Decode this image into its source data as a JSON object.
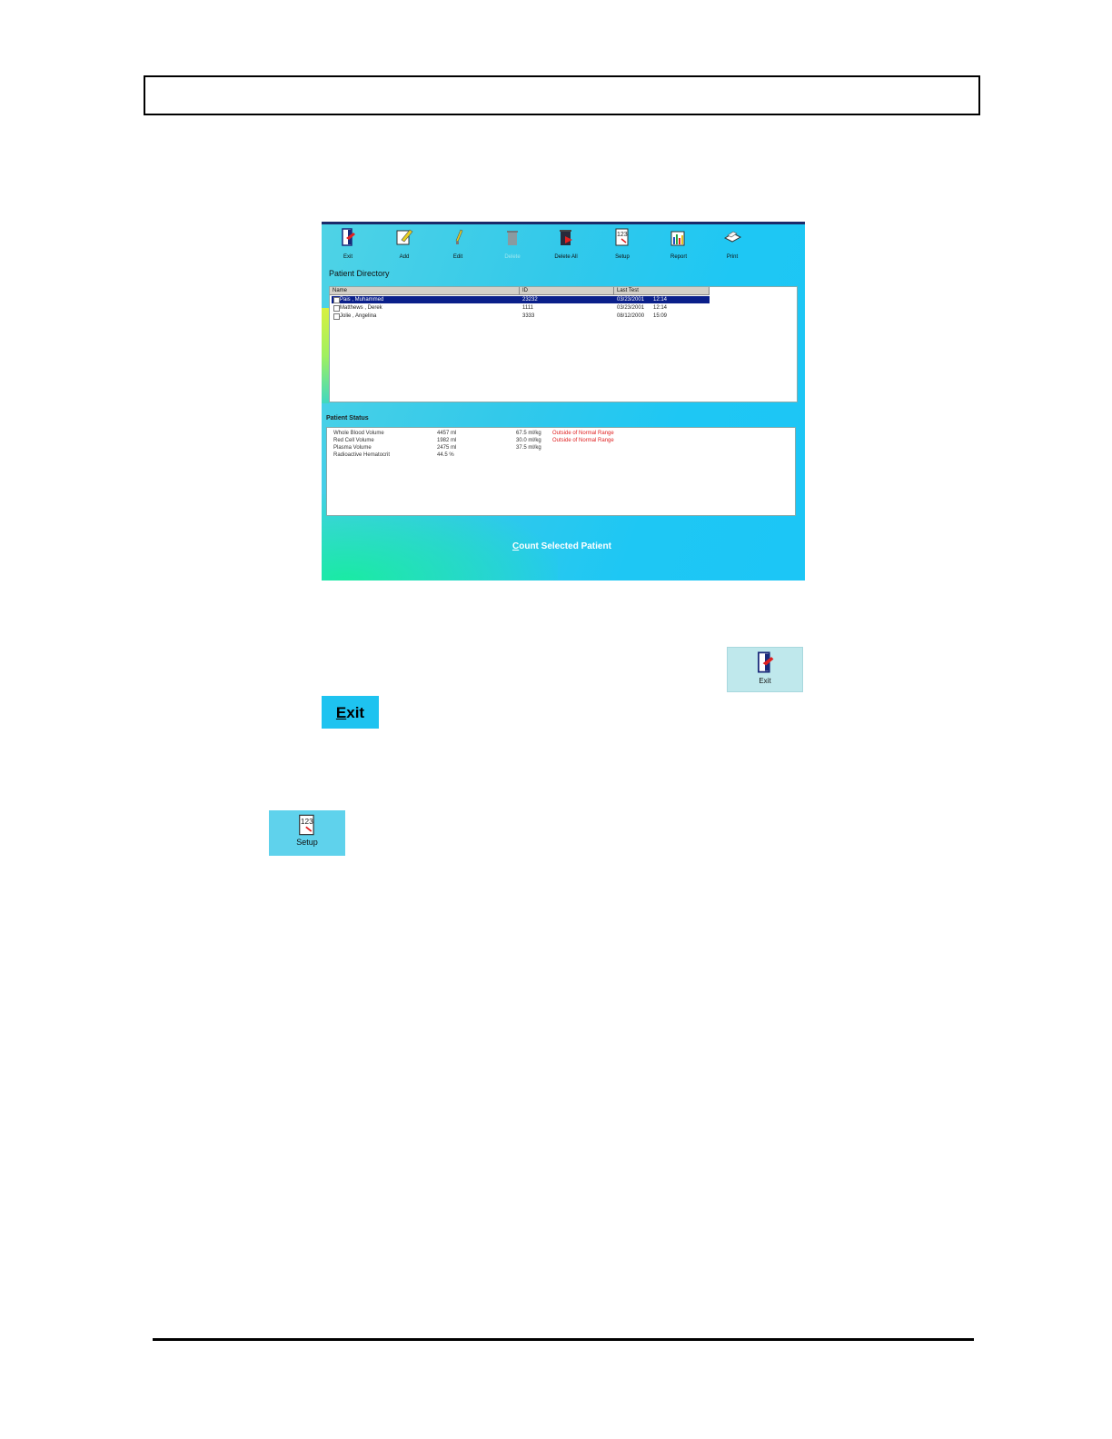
{
  "toolbar": {
    "buttons": [
      {
        "label": "Exit",
        "icon": "exit-door-icon"
      },
      {
        "label": "Add",
        "icon": "add-pencil-icon"
      },
      {
        "label": "Edit",
        "icon": "edit-pencil-icon"
      },
      {
        "label": "Delete",
        "icon": "delete-trash-icon"
      },
      {
        "label": "Delete All",
        "icon": "delete-all-icon"
      },
      {
        "label": "Setup",
        "icon": "setup-123-icon"
      },
      {
        "label": "Report",
        "icon": "report-chart-icon"
      },
      {
        "label": "Print",
        "icon": "printer-icon"
      }
    ]
  },
  "directory": {
    "title": "Patient Directory",
    "columns": [
      "Name",
      "ID",
      "Last Test"
    ],
    "rows": [
      {
        "name": "Pais , Muhammed",
        "id": "23232",
        "date": "03/23/2001",
        "time": "12:14"
      },
      {
        "name": "Matthews , Derek",
        "id": "1111",
        "date": "03/23/2001",
        "time": "12:14"
      },
      {
        "name": "Jolie , Angelina",
        "id": "3333",
        "date": "08/12/2000",
        "time": "15:09"
      }
    ]
  },
  "status": {
    "title": "Patient Status",
    "rows": [
      {
        "label": "Whole Blood Volume",
        "value": "4457 ml",
        "per_kg": "67.5 ml/kg",
        "flag": "Outside of Normal Range"
      },
      {
        "label": "Red Cell Volume",
        "value": "1982 ml",
        "per_kg": "30.0 ml/kg",
        "flag": "Outside of Normal Range"
      },
      {
        "label": "Plasma Volume",
        "value": "2475 ml",
        "per_kg": "37.5 ml/kg",
        "flag": ""
      },
      {
        "label": "Radioactive Hematocrit",
        "value": "44.5 %",
        "per_kg": "",
        "flag": ""
      }
    ]
  },
  "count_button": {
    "underlined": "C",
    "rest": "ount Selected Patient"
  },
  "exit_snapshot": {
    "label": "Exit"
  },
  "exit_button": {
    "underlined": "E",
    "rest": "xit"
  },
  "setup_snapshot": {
    "label": "Setup"
  },
  "colors": {
    "selection": "#0a1f8a",
    "flag": "#e02020",
    "panel": "#1ec7f4"
  }
}
